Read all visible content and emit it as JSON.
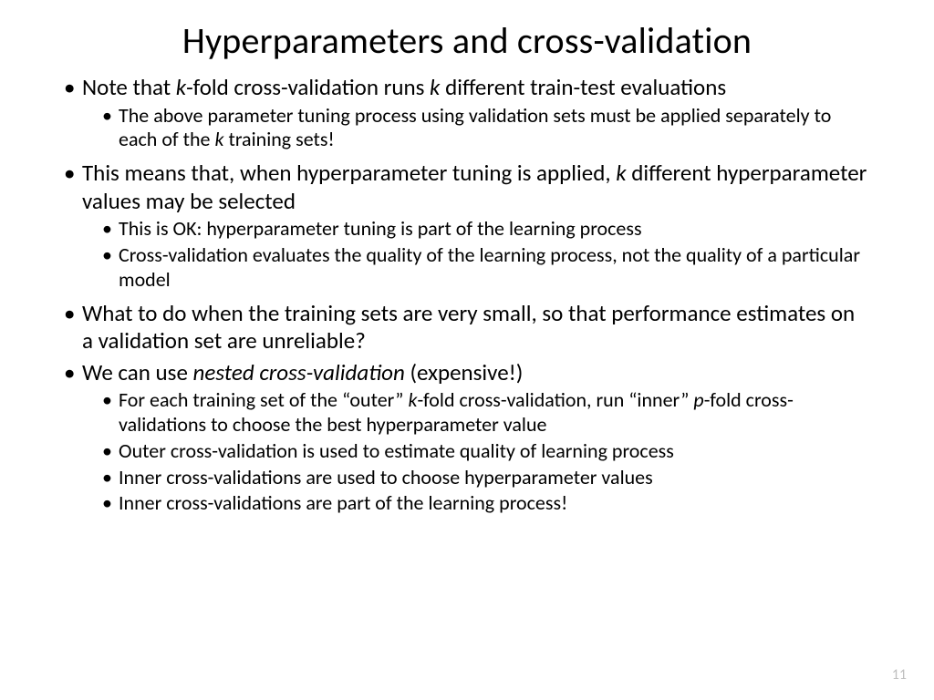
{
  "title": "Hyperparameters and cross-validation",
  "b1": {
    "pre": "Note that ",
    "em": "k",
    "post": "-fold cross-validation runs ",
    "em2": "k",
    "post2": " different train-test evaluations"
  },
  "b1s1": {
    "pre": "The above parameter tuning process using validation sets must be applied separately to each of the ",
    "em": "k",
    "post": " training sets!"
  },
  "b2": {
    "pre": "This means that, when hyperparameter tuning is applied, ",
    "em": "k",
    "post": " different hyperparameter values may be selected"
  },
  "b2s1": "This is OK: hyperparameter tuning is part of the learning process",
  "b2s2": "Cross-validation evaluates the quality of the learning process, not the quality of a particular model",
  "b3": "What to do when the training sets are very small, so that performance estimates on a validation set are unreliable?",
  "b4": {
    "pre": "We can use ",
    "em": "nested cross-validation",
    "post": " (expensive!)"
  },
  "b4s1": {
    "pre": "For each training set of the “outer” ",
    "em": "k",
    "mid": "-fold cross-validation, run “inner” ",
    "em2": "p",
    "post": "-fold cross-validations to choose the best hyperparameter value"
  },
  "b4s2": "Outer cross-validation is used to estimate quality of learning process",
  "b4s3": "Inner cross-validations are used to choose hyperparameter values",
  "b4s4": "Inner cross-validations are part of the learning process!",
  "page": "11"
}
